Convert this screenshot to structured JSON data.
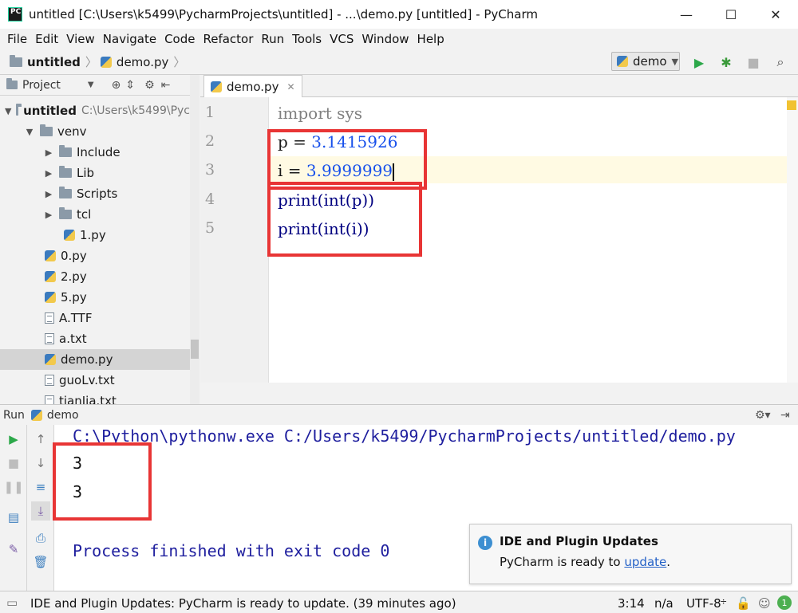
{
  "window": {
    "title": "untitled [C:\\Users\\k5499\\PycharmProjects\\untitled] - ...\\demo.py [untitled] - PyCharm",
    "logo_text": "PC",
    "minimize": "—",
    "maximize": "☐",
    "close": "✕"
  },
  "menu": [
    "File",
    "Edit",
    "View",
    "Navigate",
    "Code",
    "Refactor",
    "Run",
    "Tools",
    "VCS",
    "Window",
    "Help"
  ],
  "breadcrumb": {
    "project": "untitled",
    "file": "demo.py",
    "separator": "〉"
  },
  "toolbar": {
    "run_config": "demo",
    "run_icon": "play-icon",
    "debug_icon": "bug-icon",
    "stop_icon": "stop-icon",
    "search_icon": "search-icon"
  },
  "project_panel": {
    "title": "Project",
    "tree": [
      {
        "label": "untitled",
        "suffix": "C:\\Users\\k5499\\Pyc",
        "type": "folder",
        "expanded": true,
        "bold": true
      },
      {
        "label": "venv",
        "type": "folder",
        "expanded": true
      },
      {
        "label": "Include",
        "type": "folder",
        "expanded": false
      },
      {
        "label": "Lib",
        "type": "folder",
        "expanded": false
      },
      {
        "label": "Scripts",
        "type": "folder",
        "expanded": false
      },
      {
        "label": "tcl",
        "type": "folder",
        "expanded": false
      },
      {
        "label": "1.py",
        "type": "py"
      },
      {
        "label": "0.py",
        "type": "py"
      },
      {
        "label": "2.py",
        "type": "py"
      },
      {
        "label": "5.py",
        "type": "py"
      },
      {
        "label": "A.TTF",
        "type": "file"
      },
      {
        "label": "a.txt",
        "type": "txt"
      },
      {
        "label": "demo.py",
        "type": "py",
        "selected": true
      },
      {
        "label": "guoLv.txt",
        "type": "txt"
      },
      {
        "label": "tianJia.txt",
        "type": "txt"
      }
    ]
  },
  "editor": {
    "tab_label": "demo.py",
    "tab_close": "✕",
    "line_numbers": [
      "1",
      "2",
      "3",
      "4",
      "5"
    ],
    "lines": [
      {
        "a": "import sys"
      },
      {
        "a": "p = ",
        "b": "3.1415926"
      },
      {
        "a": "i = ",
        "b": "3.9999999"
      },
      {
        "a": "print(int(p))"
      },
      {
        "a": "print(int(i))"
      }
    ]
  },
  "run_panel": {
    "label": "Run",
    "config": "demo",
    "command": "C:\\Python\\pythonw.exe C:/Users/k5499/PycharmProjects/untitled/demo.py",
    "output": [
      "3",
      "3"
    ],
    "exit_message": "Process finished with exit code 0"
  },
  "notification": {
    "title": "IDE and Plugin Updates",
    "body_prefix": "PyCharm is ready to ",
    "link": "update",
    "body_suffix": "."
  },
  "status": {
    "message": "IDE and Plugin Updates: PyCharm is ready to update. (39 minutes ago)",
    "position": "3:14",
    "line_sep": "n/a",
    "encoding": "UTF-8",
    "event_count": "1"
  },
  "colors": {
    "highlight_box": "#e83535",
    "console_text": "#1e1e9e",
    "number_literal": "#1750eb"
  }
}
